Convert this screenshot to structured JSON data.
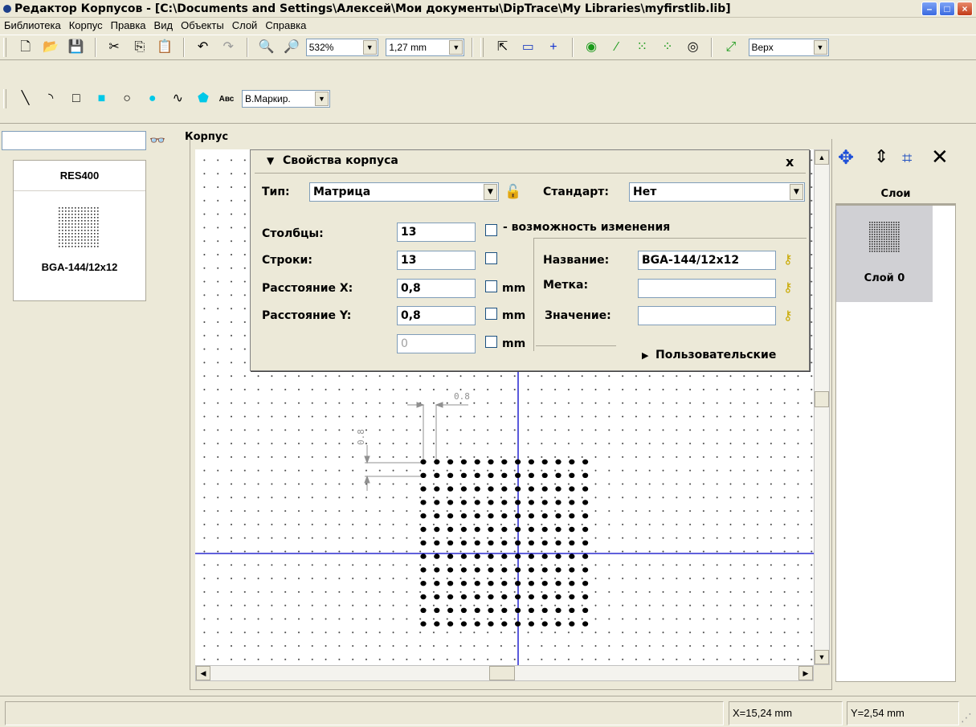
{
  "window": {
    "title": "Редактор Корпусов - [C:\\Documents and Settings\\Алексей\\Мои документы\\DipTrace\\My Libraries\\myfirstlib.lib]"
  },
  "menu": [
    "Библиотека",
    "Корпус",
    "Правка",
    "Вид",
    "Объекты",
    "Слой",
    "Справка"
  ],
  "toolbar": {
    "zoom": "532%",
    "grid": "1,27 mm",
    "side": "Верх",
    "marking": "В.Маркир.",
    "text_tool": "Авс"
  },
  "left_panel": {
    "search_value": "",
    "items": [
      "RES400",
      "BGA-144/12x12"
    ]
  },
  "canvas": {
    "frame_label": "Корпус",
    "dim_horizontal": "0.8",
    "dim_vertical": "0.8",
    "pad_rows": 13,
    "pad_cols": 13
  },
  "props": {
    "header": "Свойства корпуса",
    "close": "x",
    "type_label": "Тип:",
    "type_value": "Матрица",
    "standard_label": "Стандарт:",
    "standard_value": "Нет",
    "columns_label": "Столбцы:",
    "columns_value": "13",
    "changeable_label": "- возможность изменения",
    "rows_label": "Строки:",
    "rows_value": "13",
    "dist_x_label": "Расстояние X:",
    "dist_x_value": "0,8",
    "dist_y_label": "Расстояние Y:",
    "dist_y_value": "0,8",
    "extra_value": "0",
    "unit": "mm",
    "name_label": "Название:",
    "name_value": "BGA-144/12x12",
    "mark_label": "Метка:",
    "mark_value": "",
    "value_label": "Значение:",
    "value_value": "",
    "custom": "Пользовательские"
  },
  "layers": {
    "header": "Слои",
    "items": [
      "Слой 0"
    ]
  },
  "status": {
    "x": "X=15,24 mm",
    "y": "Y=2,54 mm"
  }
}
